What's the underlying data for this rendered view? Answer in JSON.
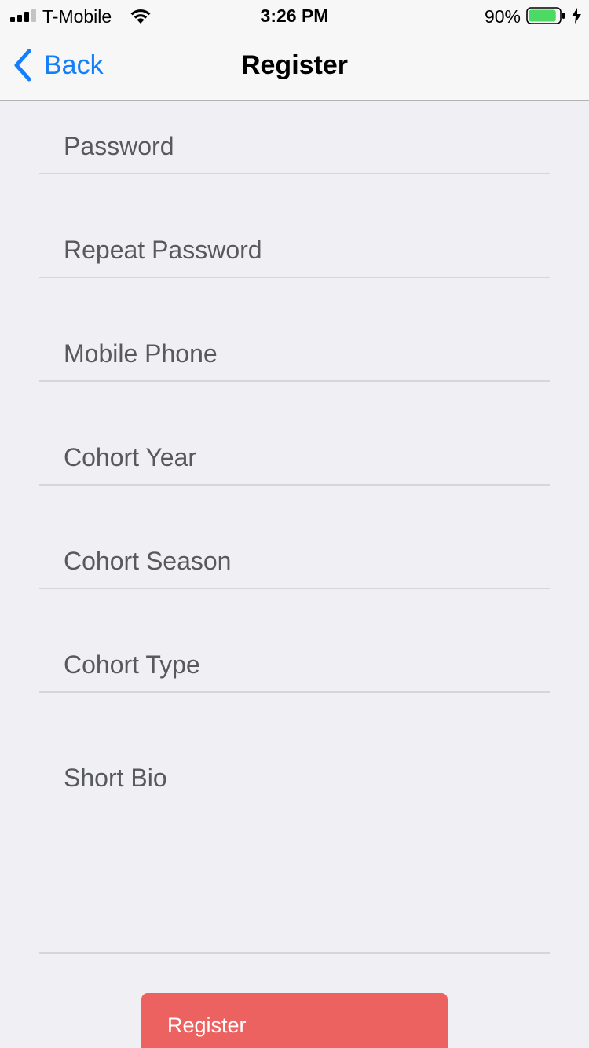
{
  "status_bar": {
    "carrier": "T-Mobile",
    "time": "3:26 PM",
    "battery_percent": "90%",
    "battery_level": 0.9,
    "battery_color": "#4cd964",
    "signal_bars_filled": 3,
    "signal_bars_total": 4
  },
  "nav": {
    "back_label": "Back",
    "title": "Register",
    "accent_color": "#147efb"
  },
  "form": {
    "fields": [
      {
        "placeholder": "Password",
        "value": ""
      },
      {
        "placeholder": "Repeat Password",
        "value": ""
      },
      {
        "placeholder": "Mobile Phone",
        "value": ""
      },
      {
        "placeholder": "Cohort Year",
        "value": ""
      },
      {
        "placeholder": "Cohort Season",
        "value": ""
      },
      {
        "placeholder": "Cohort Type",
        "value": ""
      },
      {
        "placeholder": "Short Bio",
        "value": ""
      }
    ],
    "submit_label": "Register",
    "submit_color": "#ec6260"
  }
}
